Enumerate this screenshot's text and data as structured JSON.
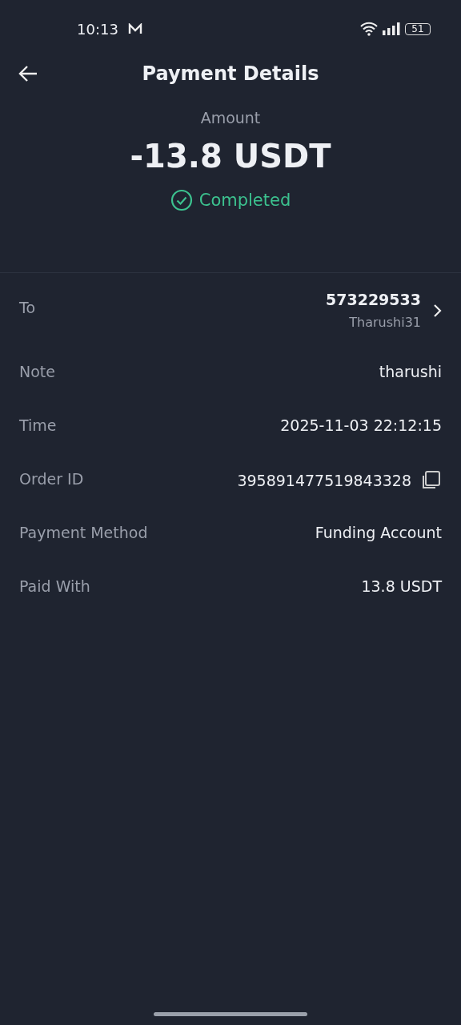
{
  "status_bar": {
    "time": "10:13",
    "battery": "51"
  },
  "header": {
    "title": "Payment Details"
  },
  "summary": {
    "label": "Amount",
    "amount": "-13.8 USDT",
    "status": {
      "kind": "completed",
      "text": "Completed"
    }
  },
  "details": [
    {
      "kind": "recipient",
      "label": "To",
      "value": "573229533",
      "subvalue": "Tharushi31"
    },
    {
      "kind": "plain",
      "label": "Note",
      "value": "tharushi"
    },
    {
      "kind": "plain",
      "label": "Time",
      "value": "2025-11-03 22:12:15"
    },
    {
      "kind": "copyable",
      "label": "Order ID",
      "value": "395891477519843328"
    },
    {
      "kind": "plain",
      "label": "Payment Method",
      "value": "Funding Account"
    },
    {
      "kind": "plain",
      "label": "Paid With",
      "value": "13.8 USDT"
    }
  ]
}
